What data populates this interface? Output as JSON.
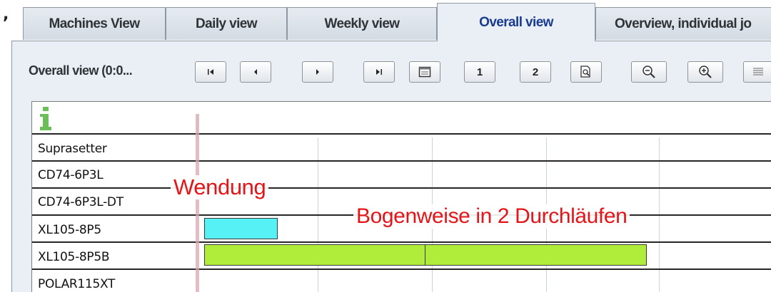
{
  "tabs": [
    {
      "label": "Machines View",
      "active": false
    },
    {
      "label": "Daily view",
      "active": false
    },
    {
      "label": "Weekly view",
      "active": false
    },
    {
      "label": "Overall view",
      "active": true
    },
    {
      "label": "Overview, individual jo",
      "active": false
    }
  ],
  "toolbar": {
    "title": "Overall view  (0:0...",
    "buttons": [
      {
        "name": "first-page-button",
        "icon": "skip-first-icon",
        "label": ""
      },
      {
        "name": "previous-button",
        "icon": "triangle-left-icon",
        "label": ""
      },
      {
        "name": "next-button",
        "icon": "triangle-right-icon",
        "label": ""
      },
      {
        "name": "last-page-button",
        "icon": "skip-last-icon",
        "label": ""
      },
      {
        "name": "layout-button",
        "icon": "window-icon",
        "label": ""
      },
      {
        "name": "view-1-button",
        "icon": "",
        "label": "1"
      },
      {
        "name": "view-2-button",
        "icon": "",
        "label": "2"
      },
      {
        "name": "zoom-fit-button",
        "icon": "zoom-page-icon",
        "label": ""
      },
      {
        "name": "zoom-out-button",
        "icon": "zoom-out-icon",
        "label": ""
      },
      {
        "name": "zoom-in-button",
        "icon": "zoom-in-icon",
        "label": ""
      },
      {
        "name": "list-button",
        "icon": "list-icon",
        "label": ""
      }
    ]
  },
  "gantt": {
    "info_icon": "info-icon",
    "machines": [
      "Suprasetter",
      "CD74-6P3L",
      "CD74-6P3L-DT",
      "XL105-8P5",
      "XL105-8P5B",
      "POLAR115XT"
    ],
    "bar_colors": {
      "cyan": "#56f1f4",
      "lime": "#b0ed3a"
    }
  },
  "annotations": {
    "wendung": "Wendung",
    "bogenweise": "Bogenweise in 2 Durchläufen",
    "color": "#e31518"
  }
}
